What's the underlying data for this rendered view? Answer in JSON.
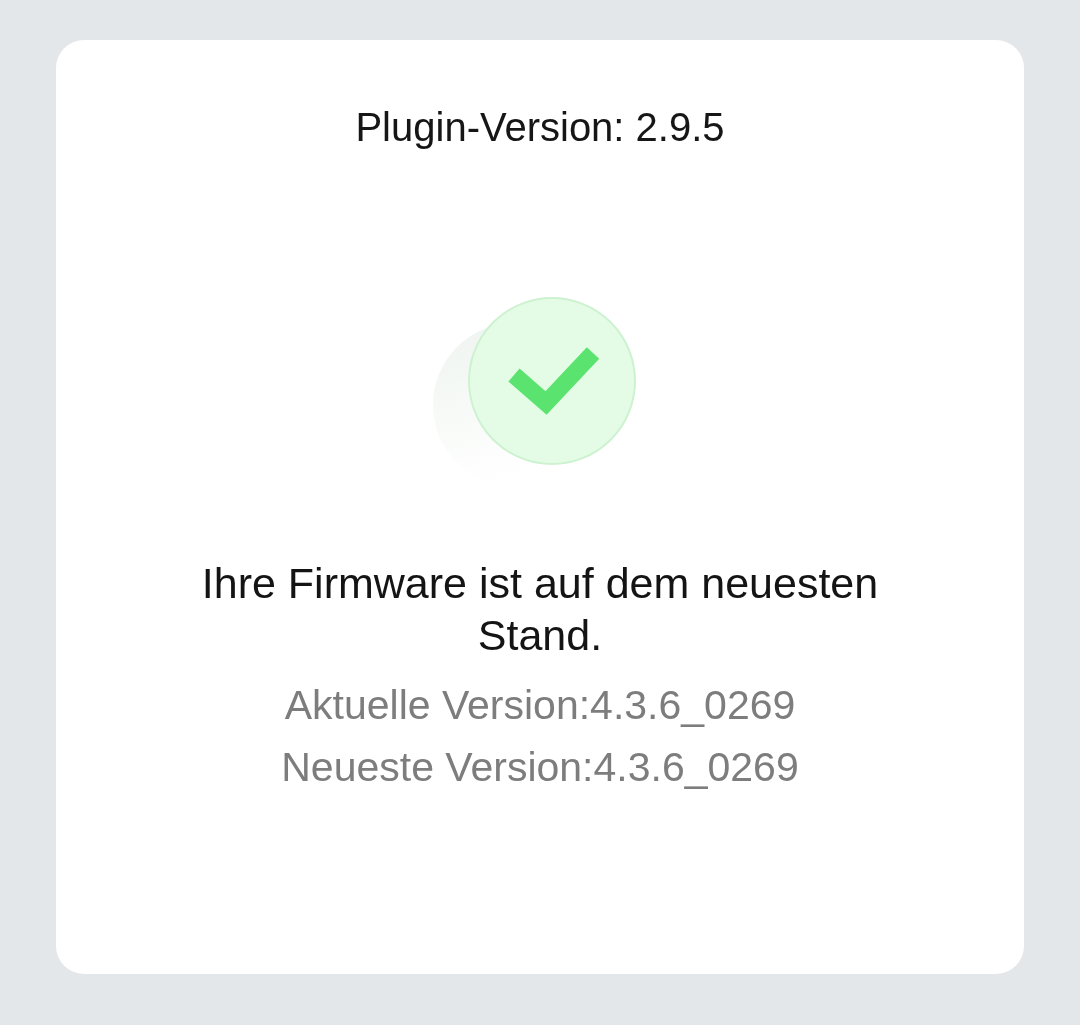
{
  "plugin_version": "Plugin-Version: 2.9.5",
  "message": "Ihre Firmware ist auf dem neuesten Stand.",
  "versions": [
    {
      "text": "Aktuelle Version:4.3.6_0269"
    },
    {
      "text": "Neueste Version:4.3.6_0269"
    }
  ]
}
